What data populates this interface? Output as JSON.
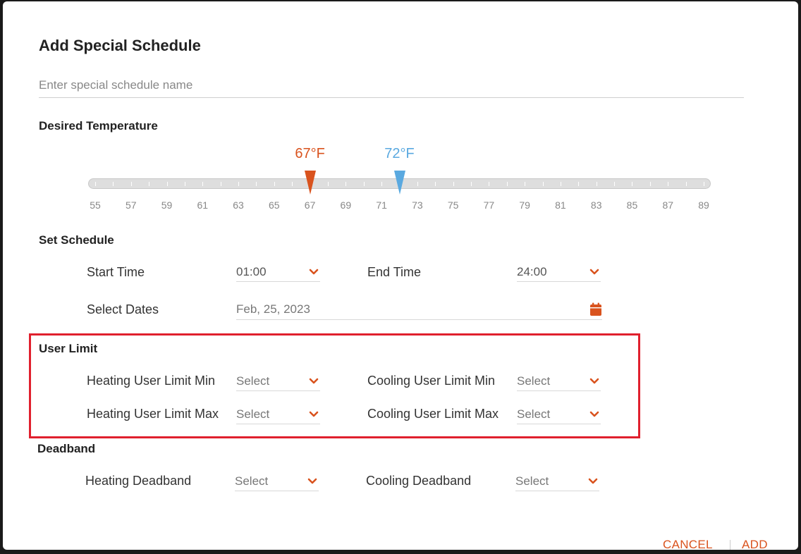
{
  "dialog": {
    "title": "Add Special Schedule",
    "name_placeholder": "Enter special schedule name"
  },
  "desired_temperature": {
    "heading": "Desired Temperature",
    "heat_setpoint_label": "67°F",
    "cool_setpoint_label": "72°F",
    "heat_setpoint": 67,
    "cool_setpoint": 72,
    "range": [
      55,
      89
    ],
    "tick_labels": [
      "55",
      "57",
      "59",
      "61",
      "63",
      "65",
      "67",
      "69",
      "71",
      "73",
      "75",
      "77",
      "79",
      "81",
      "83",
      "85",
      "87",
      "89"
    ],
    "heat_color": "#d9531e",
    "cool_color": "#5aa9e0"
  },
  "set_schedule": {
    "heading": "Set Schedule",
    "start_time_label": "Start Time",
    "start_time_value": "01:00",
    "end_time_label": "End Time",
    "end_time_value": "24:00",
    "select_dates_label": "Select Dates",
    "select_dates_value": "Feb, 25, 2023",
    "calendar_icon": "calendar-icon"
  },
  "user_limit": {
    "heading": "User Limit",
    "heating_min_label": "Heating User Limit Min",
    "heating_min_value": "Select",
    "cooling_min_label": "Cooling User Limit Min",
    "cooling_min_value": "Select",
    "heating_max_label": "Heating User Limit Max",
    "heating_max_value": "Select",
    "cooling_max_label": "Cooling User Limit Max",
    "cooling_max_value": "Select",
    "highlight_color": "#e0202e"
  },
  "deadband": {
    "heading": "Deadband",
    "heating_label": "Heating Deadband",
    "heating_value": "Select",
    "cooling_label": "Cooling Deadband",
    "cooling_value": "Select"
  },
  "footer": {
    "cancel_label": "CANCEL",
    "add_label": "ADD"
  },
  "accent_color": "#d9531e"
}
